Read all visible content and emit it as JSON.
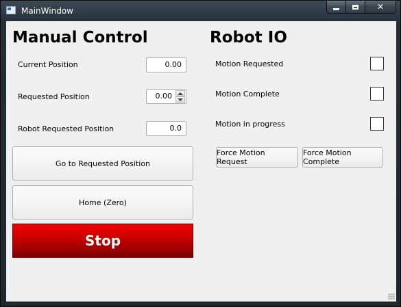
{
  "window": {
    "title": "MainWindow",
    "controls": {
      "minimize": "minimize",
      "maximize": "maximize",
      "close": "✕"
    }
  },
  "manual_control": {
    "heading": "Manual Control",
    "current_position": {
      "label": "Current Position",
      "value": "0.00"
    },
    "requested_position": {
      "label": "Requested Position",
      "value": "0.00"
    },
    "robot_requested_position": {
      "label": "Robot Requested Position",
      "value": "0.0"
    },
    "go_button": "Go to Requested Position",
    "home_button": "Home (Zero)",
    "stop_button": "Stop"
  },
  "robot_io": {
    "heading": "Robot IO",
    "motion_requested": {
      "label": "Motion Requested",
      "checked": false
    },
    "motion_complete": {
      "label": "Motion Complete",
      "checked": false
    },
    "motion_in_progress": {
      "label": "Motion in progress",
      "checked": false
    },
    "force_request_button": "Force Motion Request",
    "force_complete_button": "Force Motion Complete"
  },
  "colors": {
    "stop_red": "#c00000",
    "client_bg": "#f0f0f0",
    "titlebar": "#2a333d"
  }
}
